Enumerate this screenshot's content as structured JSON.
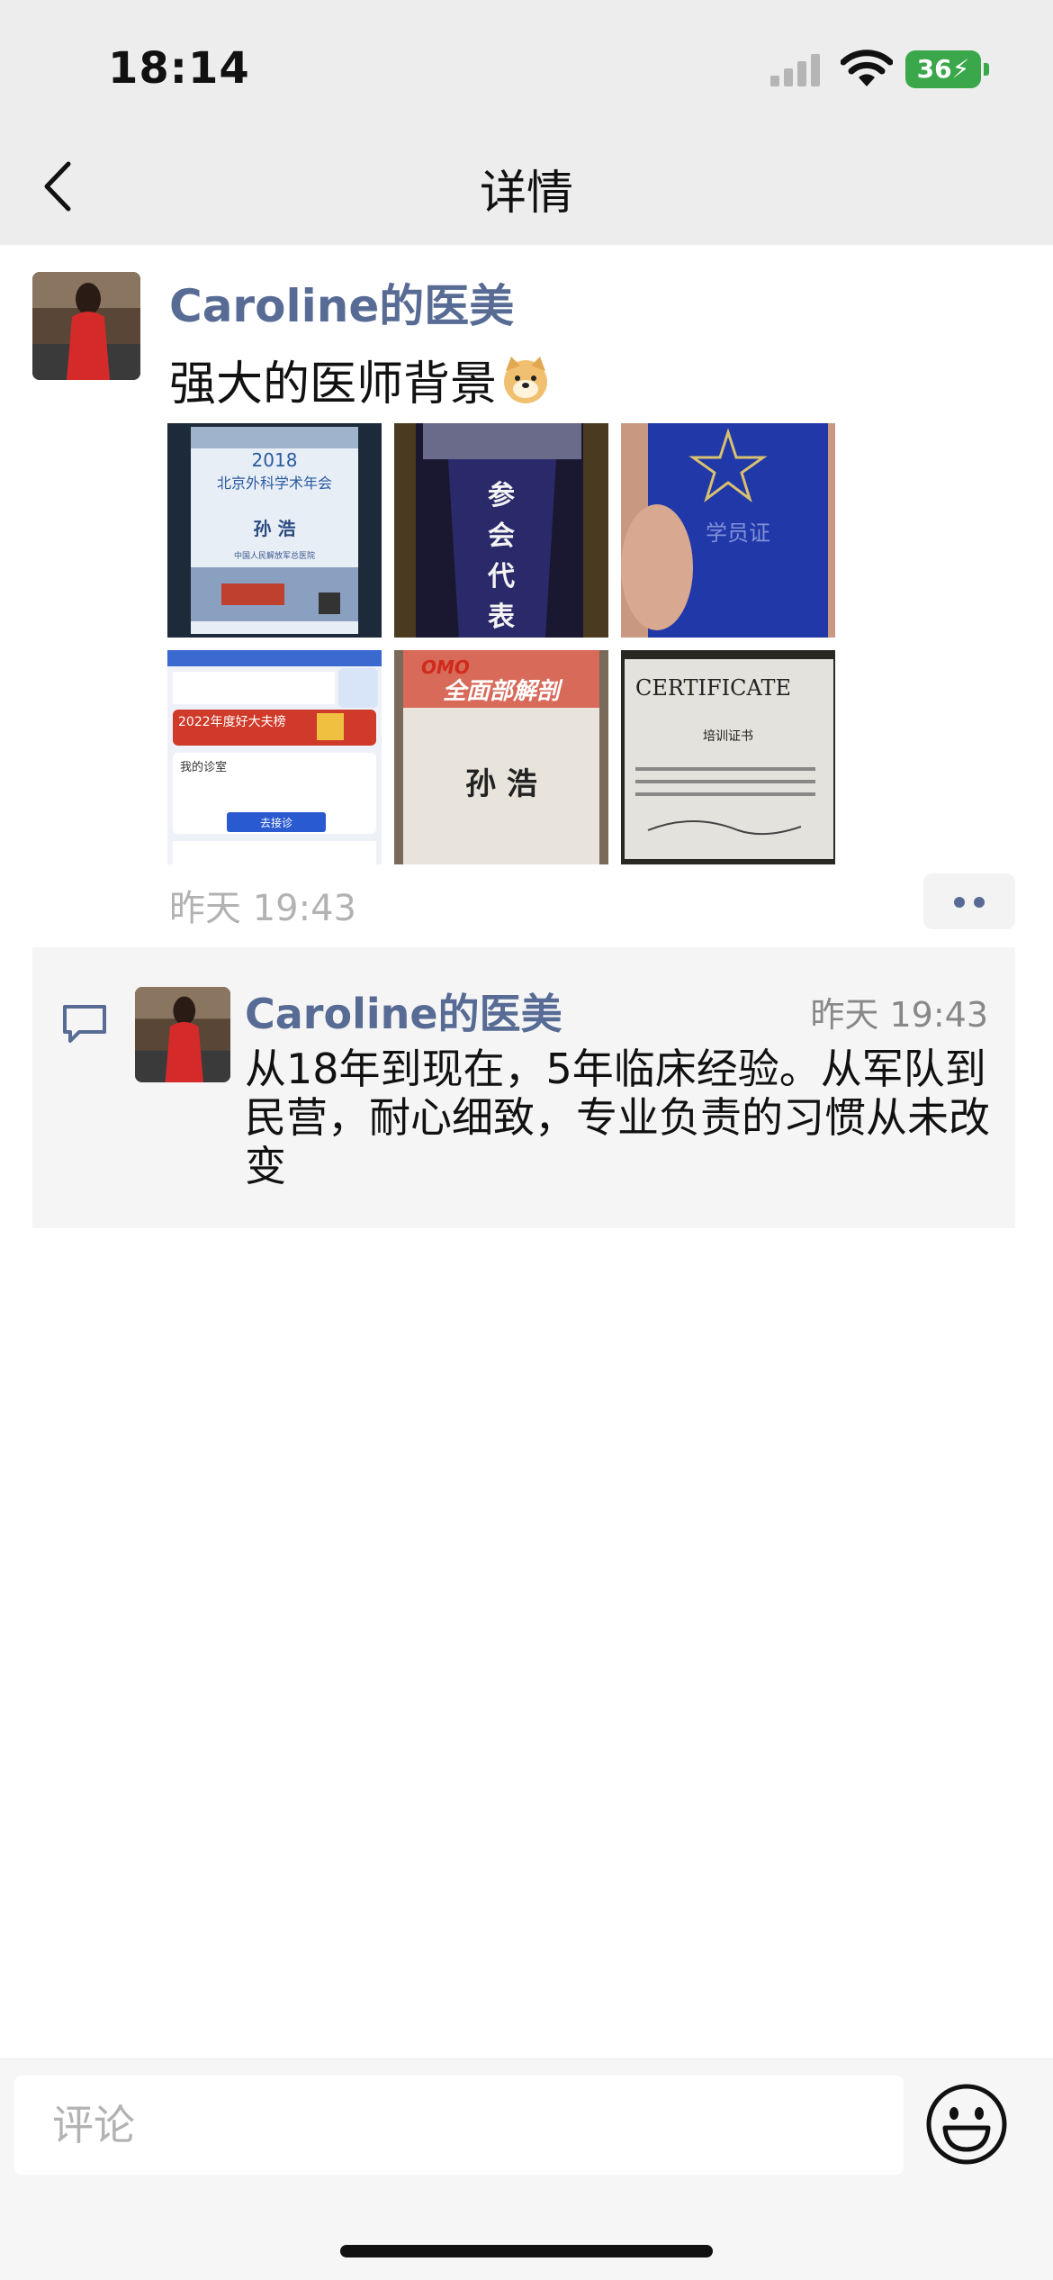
{
  "status_bar": {
    "time": "18:14",
    "battery": "36"
  },
  "nav": {
    "title": "详情"
  },
  "post": {
    "author": "Caroline的医美",
    "text": "强大的医师背景",
    "emoji": "doge-emoji",
    "time": "昨天 19:43",
    "photos": [
      {
        "name": "photo-conference-badge",
        "lines": [
          "2018",
          "北京外科学术年会",
          "孙 浩",
          "中国人民解放军总医院"
        ]
      },
      {
        "name": "photo-delegate-badge",
        "lines": [
          "参",
          "会",
          "代",
          "表"
        ]
      },
      {
        "name": "photo-student-id",
        "lines": [
          "学员证"
        ]
      },
      {
        "name": "photo-app-screenshot",
        "lines": [
          "2022年度好大夫榜",
          "我的诊室",
          "去接诊"
        ]
      },
      {
        "name": "photo-omo-badge",
        "lines": [
          "OMO",
          "全面部解剖",
          "孙 浩"
        ]
      },
      {
        "name": "photo-certificate",
        "lines": [
          "CERTIFICATE",
          "培训证书"
        ]
      }
    ]
  },
  "comment": {
    "author": "Caroline的医美",
    "time": "昨天 19:43",
    "text": "从18年到现在，5年临床经验。从军队到民营，耐心细致，专业负责的习惯从未改变"
  },
  "input": {
    "placeholder": "评论"
  },
  "colors": {
    "link": "#576b95",
    "battery": "#3aa74a",
    "header_bg": "#ededed"
  }
}
